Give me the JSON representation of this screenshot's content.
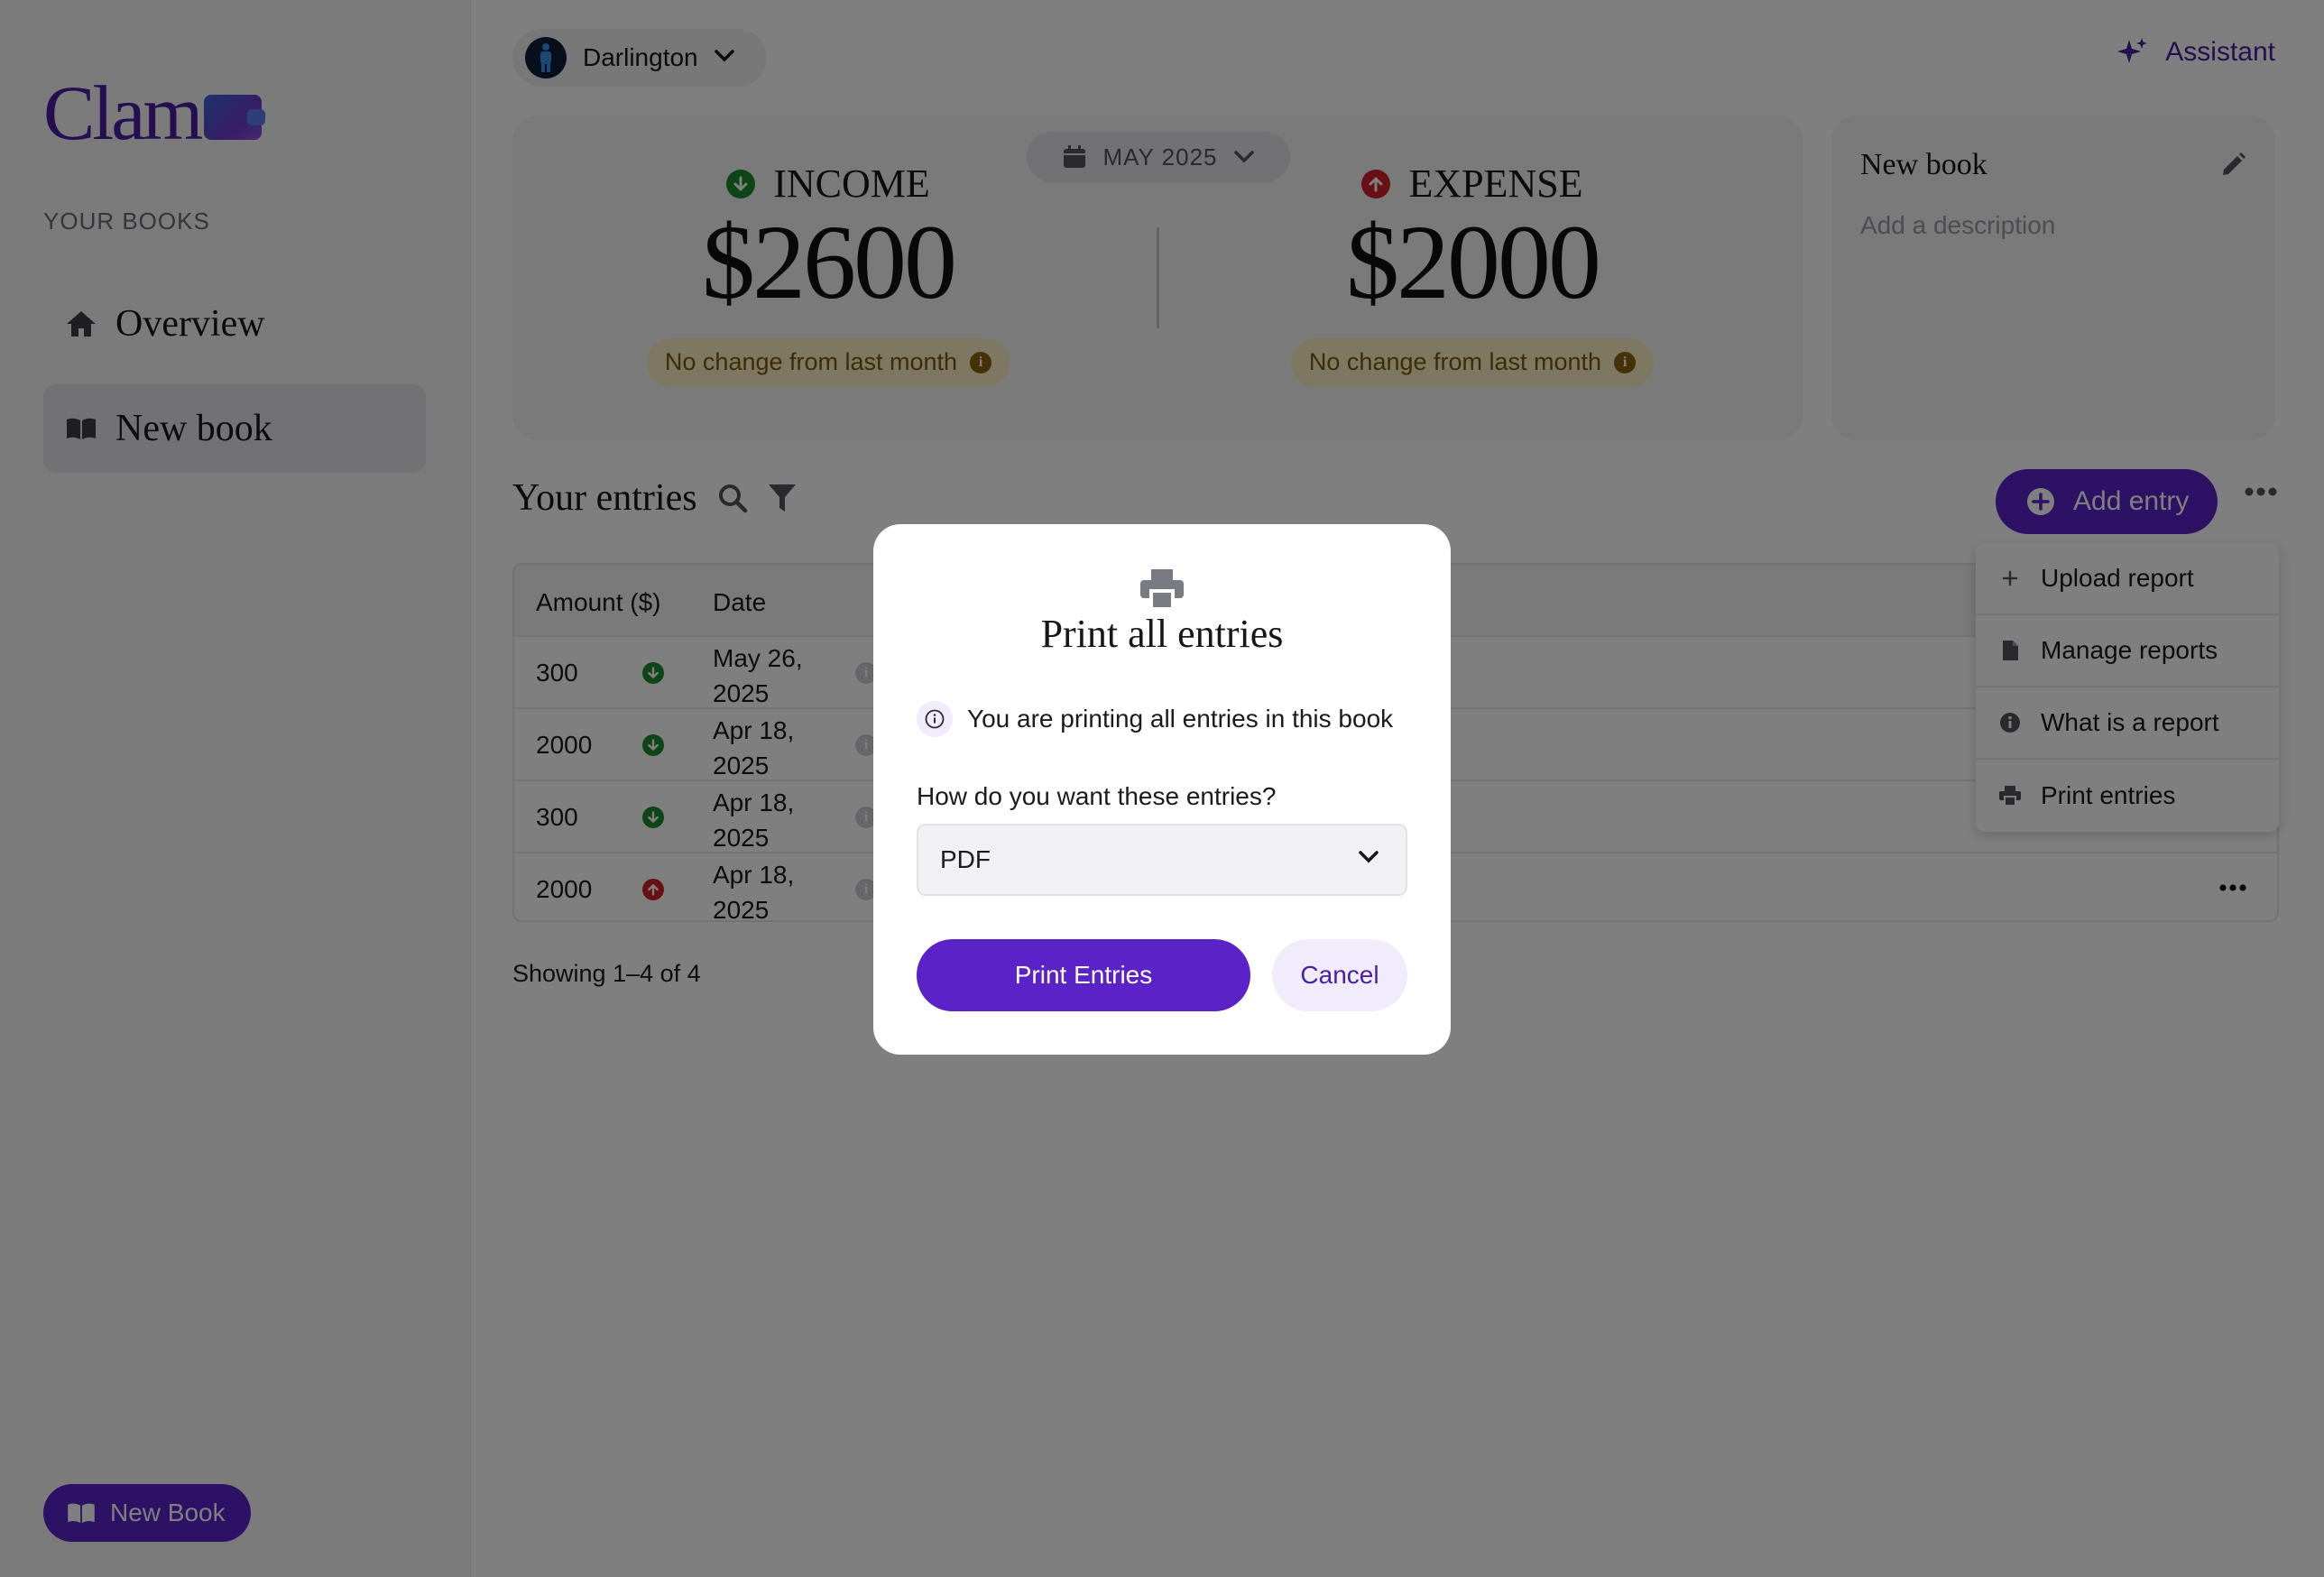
{
  "app": {
    "logo_text": "Clam"
  },
  "sidebar": {
    "section_title": "YOUR BOOKS",
    "items": [
      {
        "label": "Overview",
        "icon": "home-icon"
      },
      {
        "label": "New book",
        "icon": "book-open-icon",
        "active": true
      }
    ],
    "new_book_button": "New Book"
  },
  "header": {
    "book_selector": "Darlington",
    "assistant": "Assistant"
  },
  "summary": {
    "month": "MAY 2025",
    "income": {
      "label": "INCOME",
      "value": "$2600",
      "change": "No change from last month"
    },
    "expense": {
      "label": "EXPENSE",
      "value": "$2000",
      "change": "No change from last month"
    }
  },
  "book_card": {
    "title": "New book",
    "description_placeholder": "Add a description"
  },
  "entries": {
    "title": "Your entries",
    "add_button": "Add entry",
    "columns": [
      "Amount ($)",
      "Date"
    ],
    "rows": [
      {
        "amount": "300",
        "flow": "income",
        "date": "May 26, 2025"
      },
      {
        "amount": "2000",
        "flow": "income",
        "date": "Apr 18, 2025"
      },
      {
        "amount": "300",
        "flow": "income",
        "date": "Apr 18, 2025"
      },
      {
        "amount": "2000",
        "flow": "expense",
        "date": "Apr 18, 2025"
      }
    ],
    "showing": "Showing 1–4 of 4"
  },
  "menu": {
    "items": [
      {
        "label": "Upload report",
        "icon": "plus-icon"
      },
      {
        "label": "Manage reports",
        "icon": "file-icon"
      },
      {
        "label": "What is a report",
        "icon": "info-icon"
      },
      {
        "label": "Print entries",
        "icon": "printer-icon"
      }
    ]
  },
  "modal": {
    "title": "Print all entries",
    "note": "You are printing all entries in this book",
    "question": "How do you want these entries?",
    "format": "PDF",
    "primary_button": "Print Entries",
    "secondary_button": "Cancel"
  },
  "colors": {
    "accent": "#5b22c8",
    "income": "#1a8a2e",
    "expense": "#d0202a",
    "badge_bg": "#fcefc2"
  }
}
